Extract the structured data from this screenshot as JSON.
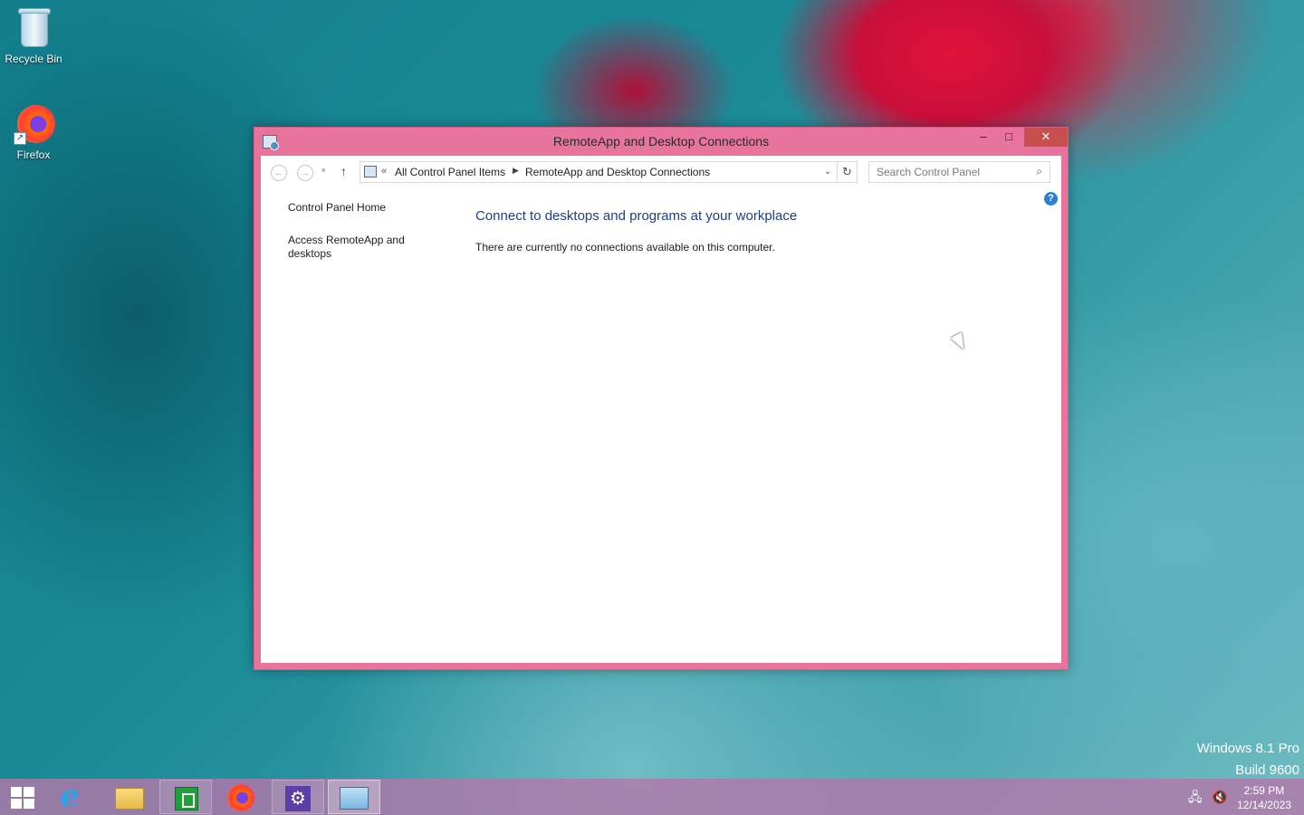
{
  "desktop": {
    "icons": [
      {
        "label": "Recycle Bin",
        "icon": "recycle-bin-icon"
      },
      {
        "label": "Firefox",
        "icon": "firefox-icon"
      }
    ],
    "watermark": {
      "line1": "Windows 8.1 Pro",
      "line2": "Build 9600"
    }
  },
  "window": {
    "title": "RemoteApp and Desktop Connections",
    "controls": {
      "minimize": "–",
      "maximize": "□",
      "close": "✕"
    },
    "nav": {
      "back": "←",
      "forward": "→",
      "recent": "▾",
      "up": "↑",
      "address_chevron": "«",
      "breadcrumb": [
        "All Control Panel Items",
        "RemoteApp and Desktop Connections"
      ],
      "breadcrumb_sep": "▶",
      "dropdown": "⌄",
      "refresh": "↻",
      "search_placeholder": "Search Control Panel",
      "search_icon": "⌕"
    },
    "help": "?",
    "left_pane": {
      "links": [
        "Control Panel Home",
        "Access RemoteApp and desktops"
      ]
    },
    "main": {
      "heading": "Connect to desktops and programs at your workplace",
      "message": "There are currently no connections available on this computer."
    }
  },
  "taskbar": {
    "items": [
      "start-button",
      "internet-explorer",
      "file-explorer",
      "store",
      "firefox",
      "settings",
      "control-panel"
    ],
    "tray": {
      "network": "🖧",
      "volume": "🔇"
    },
    "clock": {
      "time": "2:59 PM",
      "date": "12/14/2023"
    }
  },
  "colors": {
    "window_frame": "#e8739c",
    "heading_text": "#1f3e8a",
    "close_button": "#c7504f",
    "taskbar": "#b278aa"
  }
}
